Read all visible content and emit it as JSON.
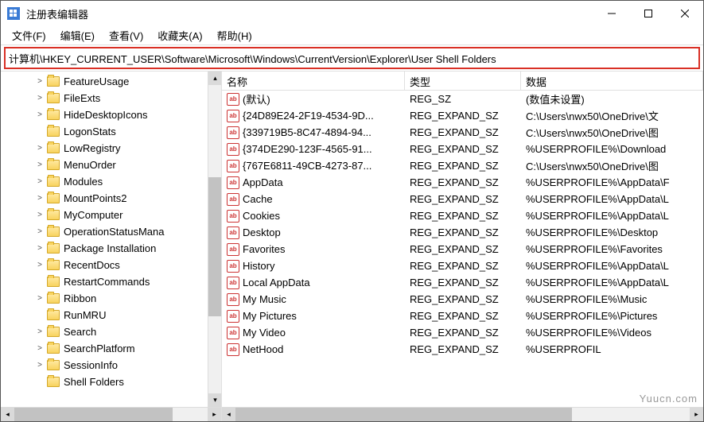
{
  "title": "注册表编辑器",
  "menu": {
    "file": "文件(F)",
    "edit": "编辑(E)",
    "view": "查看(V)",
    "favorites": "收藏夹(A)",
    "help": "帮助(H)"
  },
  "address": "计算机\\HKEY_CURRENT_USER\\Software\\Microsoft\\Windows\\CurrentVersion\\Explorer\\User Shell Folders",
  "tree": [
    {
      "label": "FeatureUsage",
      "expander": ">",
      "level": 1
    },
    {
      "label": "FileExts",
      "expander": ">",
      "level": 1
    },
    {
      "label": "HideDesktopIcons",
      "expander": ">",
      "level": 1
    },
    {
      "label": "LogonStats",
      "expander": "",
      "level": 1
    },
    {
      "label": "LowRegistry",
      "expander": ">",
      "level": 1
    },
    {
      "label": "MenuOrder",
      "expander": ">",
      "level": 1
    },
    {
      "label": "Modules",
      "expander": ">",
      "level": 1
    },
    {
      "label": "MountPoints2",
      "expander": ">",
      "level": 1
    },
    {
      "label": "MyComputer",
      "expander": ">",
      "level": 1
    },
    {
      "label": "OperationStatusMana",
      "expander": ">",
      "level": 1
    },
    {
      "label": "Package Installation",
      "expander": ">",
      "level": 1
    },
    {
      "label": "RecentDocs",
      "expander": ">",
      "level": 1
    },
    {
      "label": "RestartCommands",
      "expander": "",
      "level": 1
    },
    {
      "label": "Ribbon",
      "expander": ">",
      "level": 1
    },
    {
      "label": "RunMRU",
      "expander": "",
      "level": 1
    },
    {
      "label": "Search",
      "expander": ">",
      "level": 1
    },
    {
      "label": "SearchPlatform",
      "expander": ">",
      "level": 1
    },
    {
      "label": "SessionInfo",
      "expander": ">",
      "level": 1
    },
    {
      "label": "Shell Folders",
      "expander": "",
      "level": 1
    }
  ],
  "columns": {
    "name": "名称",
    "type": "类型",
    "data": "数据"
  },
  "rows": [
    {
      "name": "(默认)",
      "type": "REG_SZ",
      "data": "(数值未设置)"
    },
    {
      "name": "{24D89E24-2F19-4534-9D...",
      "type": "REG_EXPAND_SZ",
      "data": "C:\\Users\\nwx50\\OneDrive\\文"
    },
    {
      "name": "{339719B5-8C47-4894-94...",
      "type": "REG_EXPAND_SZ",
      "data": "C:\\Users\\nwx50\\OneDrive\\图"
    },
    {
      "name": "{374DE290-123F-4565-91...",
      "type": "REG_EXPAND_SZ",
      "data": "%USERPROFILE%\\Download"
    },
    {
      "name": "{767E6811-49CB-4273-87...",
      "type": "REG_EXPAND_SZ",
      "data": "C:\\Users\\nwx50\\OneDrive\\图"
    },
    {
      "name": "AppData",
      "type": "REG_EXPAND_SZ",
      "data": "%USERPROFILE%\\AppData\\F"
    },
    {
      "name": "Cache",
      "type": "REG_EXPAND_SZ",
      "data": "%USERPROFILE%\\AppData\\L"
    },
    {
      "name": "Cookies",
      "type": "REG_EXPAND_SZ",
      "data": "%USERPROFILE%\\AppData\\L"
    },
    {
      "name": "Desktop",
      "type": "REG_EXPAND_SZ",
      "data": "%USERPROFILE%\\Desktop"
    },
    {
      "name": "Favorites",
      "type": "REG_EXPAND_SZ",
      "data": "%USERPROFILE%\\Favorites"
    },
    {
      "name": "History",
      "type": "REG_EXPAND_SZ",
      "data": "%USERPROFILE%\\AppData\\L"
    },
    {
      "name": "Local AppData",
      "type": "REG_EXPAND_SZ",
      "data": "%USERPROFILE%\\AppData\\L"
    },
    {
      "name": "My Music",
      "type": "REG_EXPAND_SZ",
      "data": "%USERPROFILE%\\Music"
    },
    {
      "name": "My Pictures",
      "type": "REG_EXPAND_SZ",
      "data": "%USERPROFILE%\\Pictures"
    },
    {
      "name": "My Video",
      "type": "REG_EXPAND_SZ",
      "data": "%USERPROFILE%\\Videos"
    },
    {
      "name": "NetHood",
      "type": "REG_EXPAND_SZ",
      "data": "%USERPROFIL"
    }
  ],
  "watermark": "Yuucn.com"
}
